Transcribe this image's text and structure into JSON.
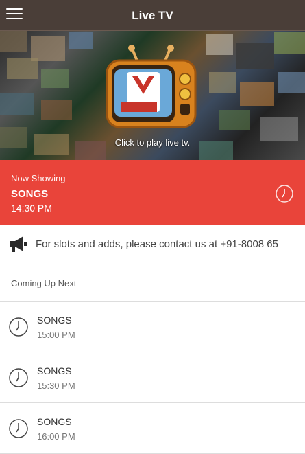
{
  "appbar": {
    "title": "Live TV",
    "menu_icon": "hamburger-menu-icon"
  },
  "hero": {
    "caption": "Click to play live tv.",
    "tv_icon": "retro-tv-icon"
  },
  "now_showing": {
    "label": "Now Showing",
    "title": "SONGS",
    "time": "14:30 PM",
    "icon": "clock-icon"
  },
  "contact": {
    "text": "For slots and adds, please contact us at +91-8008 65",
    "icon": "megaphone-icon"
  },
  "coming_up": {
    "label": "Coming Up Next"
  },
  "schedule": [
    {
      "title": "SONGS",
      "time": "15:00 PM"
    },
    {
      "title": "SONGS",
      "time": "15:30 PM"
    },
    {
      "title": "SONGS",
      "time": "16:00 PM"
    }
  ],
  "colors": {
    "appbar": "#4a3e38",
    "now_showing_bg": "#e9443a",
    "divider": "#dddddd"
  }
}
